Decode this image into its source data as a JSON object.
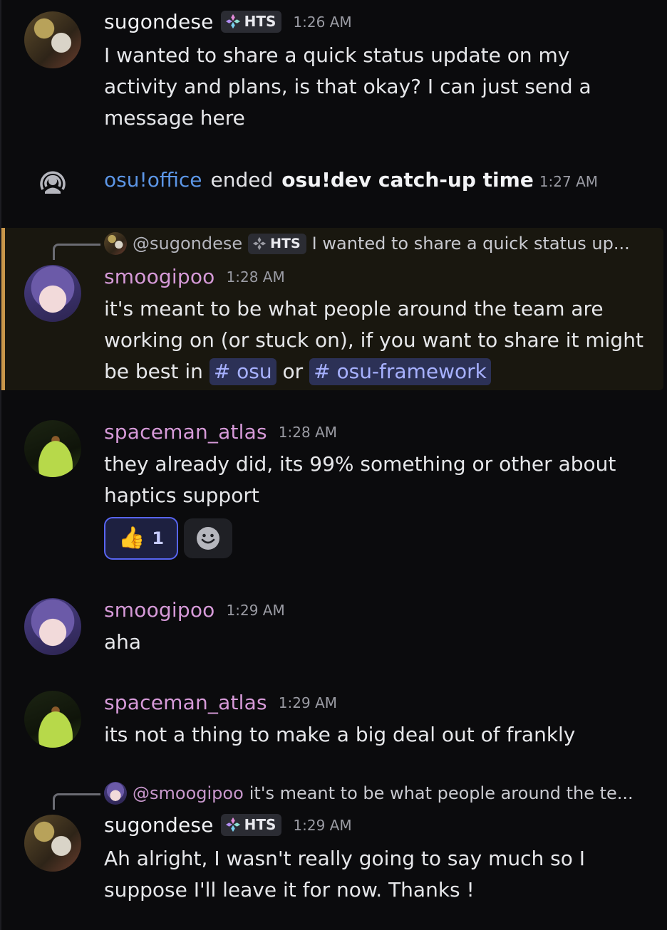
{
  "messages": {
    "m1": {
      "username": "sugondese",
      "tag": "HTS",
      "time": "1:26 AM",
      "text": "I wanted to share a quick status update on my activity and plans, is that okay? I can just send a message here"
    },
    "system": {
      "actor": "osu!office",
      "verb": "ended",
      "event": "osu!dev catch-up time",
      "time": "1:27 AM"
    },
    "m2": {
      "reply_user": "@sugondese",
      "reply_tag": "HTS",
      "reply_text": "I wanted to share a quick status up...",
      "username": "smoogipoo",
      "time": "1:28 AM",
      "text_before": "it's meant to be what people around the team are working on (or stuck on), if you want to share it might be best in",
      "channel1": "# osu",
      "text_or": "or",
      "channel2": "# osu-framework"
    },
    "m3": {
      "username": "spaceman_atlas",
      "time": "1:28 AM",
      "text": "they already did, its 99% something or other about haptics support",
      "reaction_emoji": "👍",
      "reaction_count": "1"
    },
    "m4": {
      "username": "smoogipoo",
      "time": "1:29 AM",
      "text": "aha"
    },
    "m5": {
      "username": "spaceman_atlas",
      "time": "1:29 AM",
      "text": "its not a thing to make a big deal out of frankly"
    },
    "m6": {
      "reply_user": "@smoogipoo",
      "reply_text": "it's meant to be what people around the te...",
      "username": "sugondese",
      "tag": "HTS",
      "time": "1:29 AM",
      "text": "Ah alright, I wasn't really going to say much so I suppose I'll leave it for now. Thanks !"
    }
  },
  "colors": {
    "background": "#0b0b0d",
    "highlight_border": "#c8964a",
    "mention_link": "#5c96e6",
    "username_pink": "#d69ad8",
    "reaction_border": "#5865f2"
  }
}
